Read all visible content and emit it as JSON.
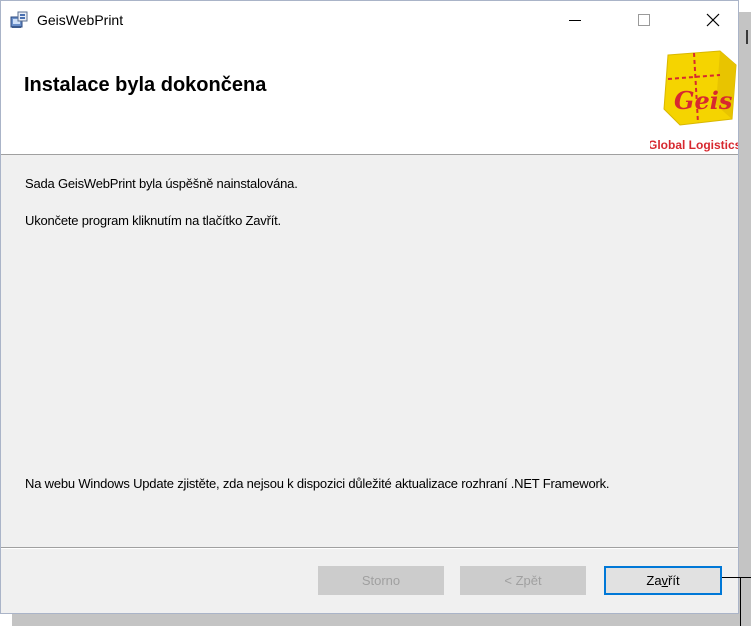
{
  "window": {
    "title": "GeisWebPrint",
    "controls": {
      "minimize": "–",
      "maximize": "□",
      "close": "✕"
    }
  },
  "header": {
    "title": "Instalace byla dokončena",
    "logo": {
      "mark_text": "Geis",
      "caption": "Global Logistics",
      "box_color": "#f5d400",
      "text_color": "#d7282f"
    }
  },
  "content": {
    "line1": "Sada GeisWebPrint byla úspěšně nainstalována.",
    "line2": "Ukončete program kliknutím na tlačítko Zavřít.",
    "note": "Na webu Windows Update zjistěte, zda nejsou k dispozici důležité aktualizace rozhraní .NET Framework."
  },
  "buttons": {
    "cancel": "Storno",
    "back": "< Zpět",
    "close_prefix": "Za",
    "close_accel": "v",
    "close_suffix": "řít"
  },
  "colors": {
    "accent": "#0078d7",
    "disabled_bg": "#cccccc",
    "disabled_text": "#a0a0a0"
  }
}
